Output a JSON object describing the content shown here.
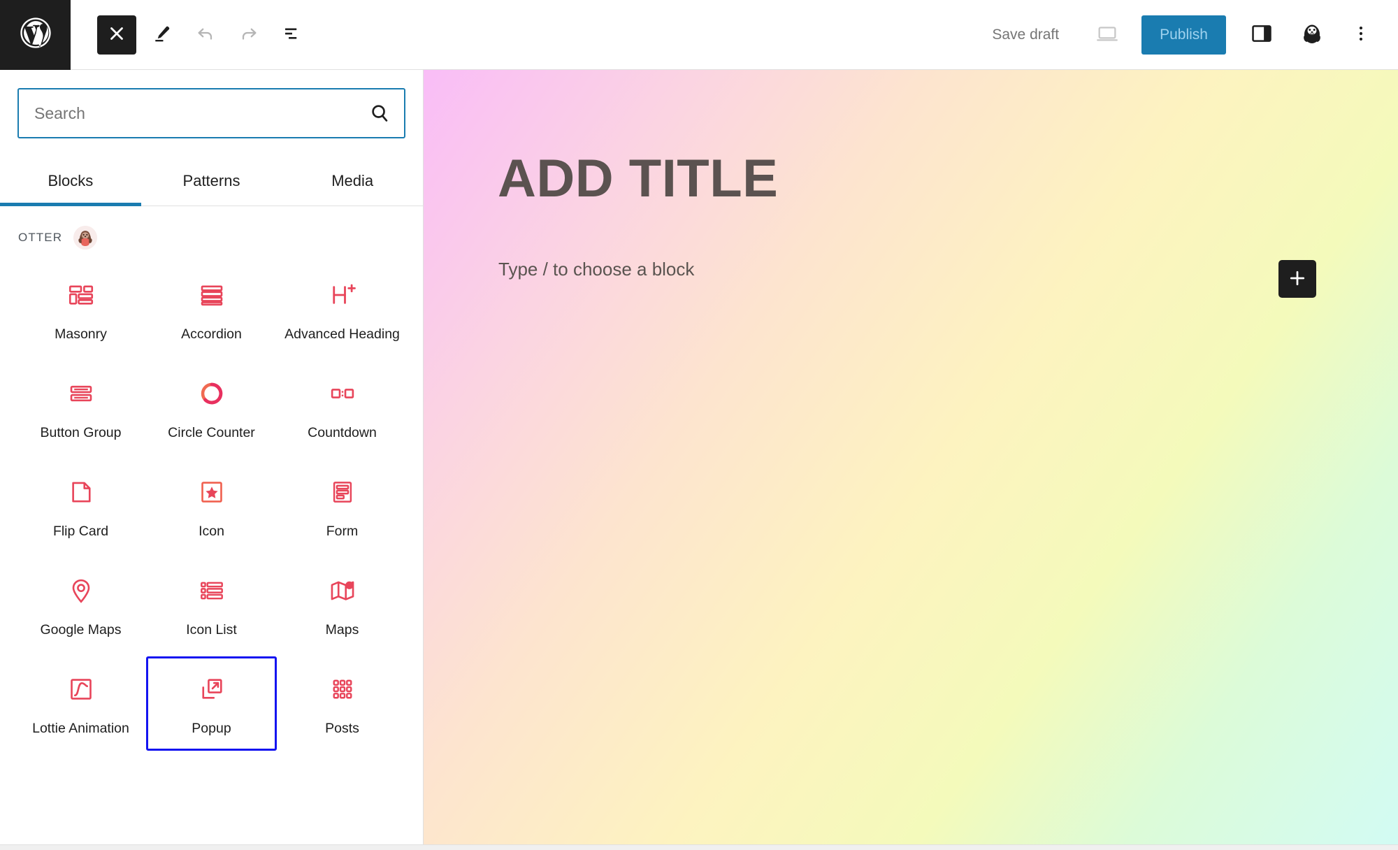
{
  "toolbar": {
    "logo_icon": "wordpress-logo-icon",
    "close_icon": "close-icon",
    "edit_icon": "pencil-edit-icon",
    "undo_icon": "undo-icon",
    "redo_icon": "redo-icon",
    "list_view_icon": "document-overview-icon",
    "save_draft_label": "Save draft",
    "preview_icon": "preview-desktop-icon",
    "publish_label": "Publish",
    "publish_color": "#1a7cb0",
    "publish_text_color": "#9fd2ee",
    "sidebar_toggle_icon": "settings-sidebar-icon",
    "otter_avatar_icon": "otter-mascot-icon",
    "kebab_icon": "more-options-icon"
  },
  "inserter": {
    "search": {
      "placeholder": "Search",
      "value": "",
      "icon": "search-icon",
      "focus_border_color": "#1a7cb0"
    },
    "tabs": [
      {
        "label": "Blocks",
        "active": true
      },
      {
        "label": "Patterns",
        "active": false
      },
      {
        "label": "Media",
        "active": false
      }
    ],
    "category": {
      "title": "OTTER",
      "badge_icon": "otter-mascot-icon"
    },
    "selection_color": "#1414f0",
    "icon_color": "#e8455a",
    "blocks": [
      {
        "label": "Masonry",
        "icon": "masonry-icon",
        "selected": false
      },
      {
        "label": "Accordion",
        "icon": "accordion-icon",
        "selected": false
      },
      {
        "label": "Advanced Heading",
        "icon": "advanced-heading-icon",
        "selected": false
      },
      {
        "label": "Button Group",
        "icon": "button-group-icon",
        "selected": false
      },
      {
        "label": "Circle Counter",
        "icon": "circle-counter-icon",
        "selected": false
      },
      {
        "label": "Countdown",
        "icon": "countdown-icon",
        "selected": false
      },
      {
        "label": "Flip Card",
        "icon": "flip-card-icon",
        "selected": false
      },
      {
        "label": "Icon",
        "icon": "star-icon",
        "selected": false
      },
      {
        "label": "Form",
        "icon": "form-icon",
        "selected": false
      },
      {
        "label": "Google Maps",
        "icon": "map-pin-icon",
        "selected": false
      },
      {
        "label": "Icon List",
        "icon": "icon-list-icon",
        "selected": false
      },
      {
        "label": "Maps",
        "icon": "maps-icon",
        "selected": false
      },
      {
        "label": "Lottie Animation",
        "icon": "lottie-animation-icon",
        "selected": false
      },
      {
        "label": "Popup",
        "icon": "popup-icon",
        "selected": true
      },
      {
        "label": "Posts",
        "icon": "posts-grid-icon",
        "selected": false
      }
    ]
  },
  "canvas": {
    "title": "ADD TITLE",
    "paragraph_placeholder": "Type / to choose a block",
    "add_block_icon": "plus-icon",
    "gradient_start": "#f9bdf7",
    "gradient_mid": "#fdf3c0",
    "gradient_end": "#d2fbf4"
  }
}
